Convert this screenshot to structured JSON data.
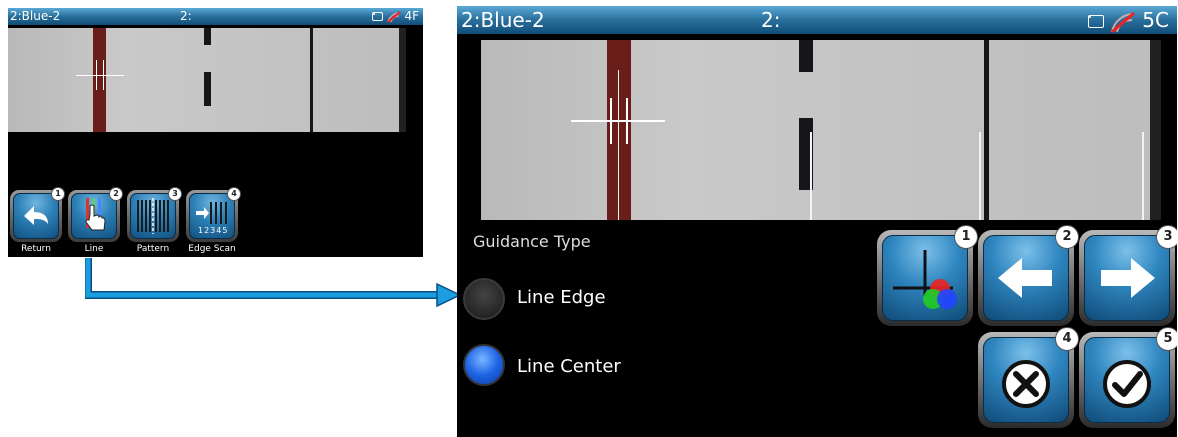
{
  "small_screen": {
    "title_left": "2:Blue-2",
    "title_mid": "2:",
    "title_right": "4F",
    "icons": [
      "camera-icon",
      "signal-off-icon"
    ],
    "buttons": [
      {
        "label": "Return",
        "number": "1",
        "icon": "return-arrow-icon"
      },
      {
        "label": "Line",
        "number": "2",
        "icon": "line-pointer-icon"
      },
      {
        "label": "Pattern",
        "number": "3",
        "icon": "pattern-icon"
      },
      {
        "label": "Edge Scan",
        "number": "4",
        "icon": "edge-scan-icon"
      }
    ],
    "edge_scan_digits": "12345"
  },
  "large_screen": {
    "title_left": "2:Blue-2",
    "title_mid": "2:",
    "title_right": "5C",
    "icons": [
      "camera-icon",
      "signal-off-icon"
    ],
    "guidance_heading": "Guidance Type",
    "options": [
      {
        "label": "Line Edge",
        "selected": false
      },
      {
        "label": "Line Center",
        "selected": true
      }
    ],
    "buttons": [
      {
        "number": "1",
        "icon": "color-crosshair-icon"
      },
      {
        "number": "2",
        "icon": "arrow-left-icon"
      },
      {
        "number": "3",
        "icon": "arrow-right-icon"
      },
      {
        "number": "4",
        "icon": "cancel-icon"
      },
      {
        "number": "5",
        "icon": "confirm-check-icon"
      }
    ]
  },
  "colors": {
    "titlebar": "#2a6f9c",
    "button_face": "#2c7fb6",
    "connector_arrow": "#1a9ee0",
    "selected_radio": "#1e64e6",
    "guide_line": "#6a1e1a"
  }
}
